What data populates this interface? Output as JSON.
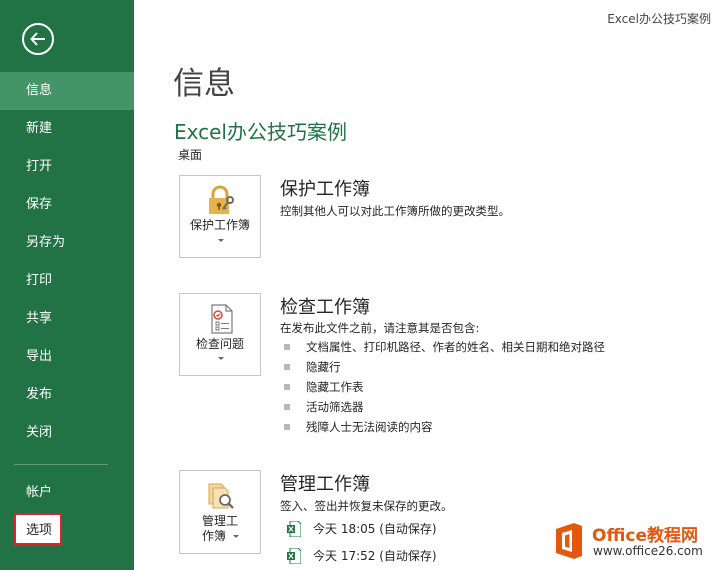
{
  "window_title": "Excel办公技巧案例",
  "sidebar": {
    "items": [
      {
        "label": "信息",
        "active": true
      },
      {
        "label": "新建"
      },
      {
        "label": "打开"
      },
      {
        "label": "保存"
      },
      {
        "label": "另存为"
      },
      {
        "label": "打印"
      },
      {
        "label": "共享"
      },
      {
        "label": "导出"
      },
      {
        "label": "发布"
      },
      {
        "label": "关闭"
      }
    ],
    "bottom_items": [
      {
        "label": "帐户"
      },
      {
        "label": "选项",
        "highlighted": true
      }
    ]
  },
  "main": {
    "title": "信息",
    "doc_name": "Excel办公技巧案例",
    "doc_location": "桌面",
    "protect": {
      "tile_label": "保护工作簿",
      "title": "保护工作簿",
      "description": "控制其他人可以对此工作簿所做的更改类型。"
    },
    "inspect": {
      "tile_label": "检查问题",
      "title": "检查工作簿",
      "description": "在发布此文件之前，请注意其是否包含:",
      "bullets": [
        "文档属性、打印机路径、作者的姓名、相关日期和绝对路径",
        "隐藏行",
        "隐藏工作表",
        "活动筛选器",
        "残障人士无法阅读的内容"
      ]
    },
    "manage": {
      "tile_label_line1": "管理工",
      "tile_label_line2": "作簿",
      "title": "管理工作簿",
      "description": "签入、签出并恢复未保存的更改。",
      "versions": [
        "今天 18:05 (自动保存)",
        "今天 17:52 (自动保存)"
      ]
    }
  },
  "watermark": {
    "brand": "Office教程网",
    "url": "www.office26.com"
  },
  "colors": {
    "accent": "#217346",
    "active_item": "#439467",
    "highlight_border": "#e0222b",
    "watermark_orange": "#e3570e"
  }
}
